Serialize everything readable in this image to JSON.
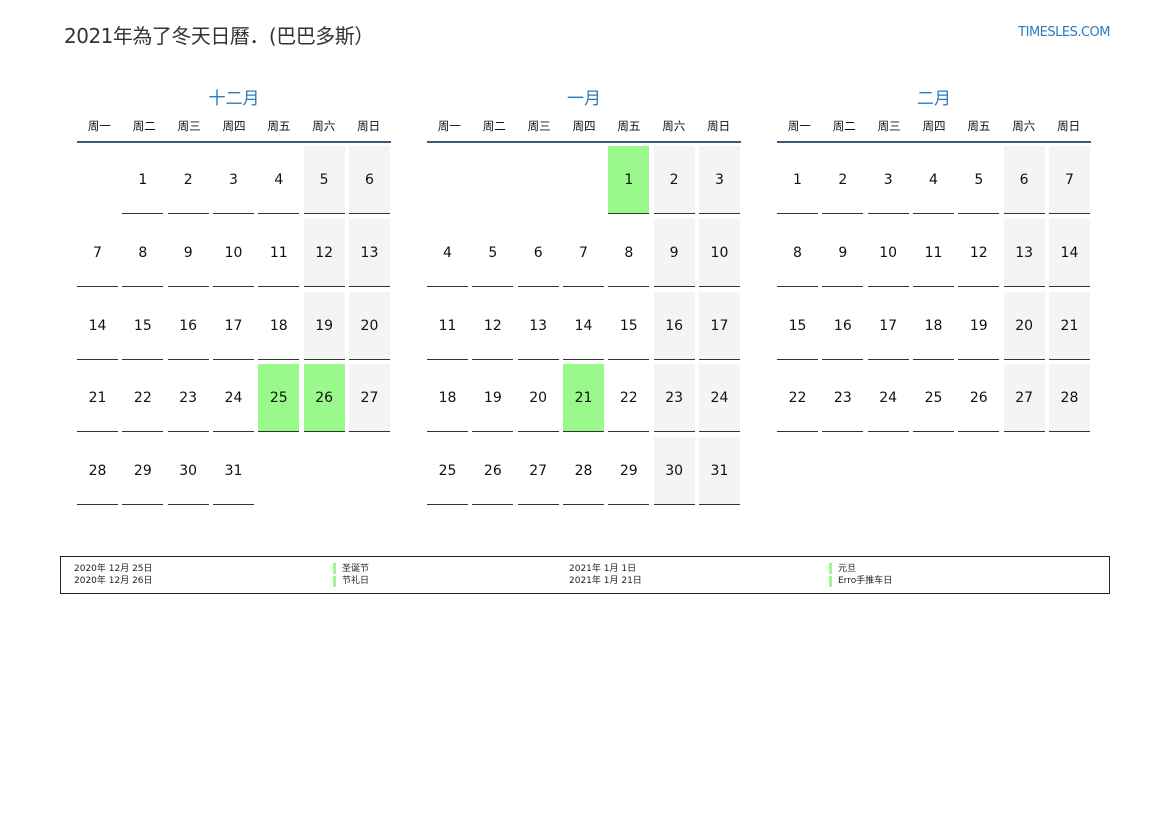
{
  "title": "2021年為了冬天日曆．(巴巴多斯）",
  "site": "TIMESLES.COM",
  "weekdays": [
    "周一",
    "周二",
    "周三",
    "周四",
    "周五",
    "周六",
    "周日"
  ],
  "colors": {
    "accent": "#2a7bbf",
    "holiday": "#99f98a",
    "weekend": "#f4f4f4"
  },
  "months": [
    {
      "name": "十二月",
      "offset": 1,
      "days": 31,
      "holidays": [
        25,
        26
      ]
    },
    {
      "name": "一月",
      "offset": 4,
      "days": 31,
      "holidays": [
        1,
        21
      ]
    },
    {
      "name": "二月",
      "offset": 0,
      "days": 28,
      "holidays": []
    }
  ],
  "legend": [
    {
      "date": "2020年 12月 25日",
      "name": "圣诞节"
    },
    {
      "date": "2020年 12月 26日",
      "name": "节礼日"
    },
    {
      "date": "2021年 1月 1日",
      "name": "元旦"
    },
    {
      "date": "2021年 1月 21日",
      "name": "Erro手推车日"
    }
  ]
}
